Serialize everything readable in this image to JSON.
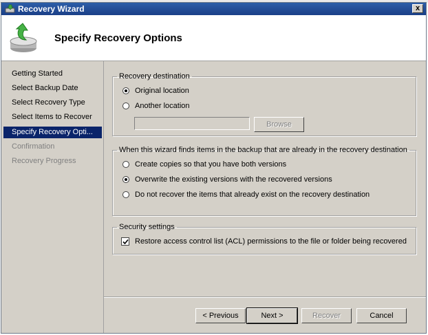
{
  "window": {
    "title": "Recovery Wizard",
    "close_label": "x"
  },
  "header": {
    "page_title": "Specify Recovery Options",
    "icon": "backup-restore-icon"
  },
  "nav": {
    "items": [
      {
        "label": "Getting Started",
        "state": "normal"
      },
      {
        "label": "Select Backup Date",
        "state": "normal"
      },
      {
        "label": "Select Recovery Type",
        "state": "normal"
      },
      {
        "label": "Select Items to Recover",
        "state": "normal"
      },
      {
        "label": "Specify Recovery Opti...",
        "state": "active"
      },
      {
        "label": "Confirmation",
        "state": "disabled"
      },
      {
        "label": "Recovery Progress",
        "state": "disabled"
      }
    ]
  },
  "destination": {
    "legend": "Recovery destination",
    "original_label": "Original location",
    "another_label": "Another location",
    "selected": "original",
    "path_value": "",
    "browse_label": "Browse"
  },
  "conflict": {
    "legend": "When this wizard finds items in the backup that are already in the recovery destination",
    "options": [
      "Create copies so that you have both versions",
      "Overwrite the existing versions with the recovered versions",
      "Do not recover the items that already exist on the recovery destination"
    ],
    "selected_index": 1
  },
  "security": {
    "legend": "Security settings",
    "acl_label": "Restore access control list (ACL) permissions to the file or folder being recovered",
    "acl_checked": true
  },
  "buttons": {
    "previous": "< Previous",
    "next": "Next >",
    "recover": "Recover",
    "cancel": "Cancel"
  },
  "colors": {
    "title_bar": "#1b3f87",
    "selection": "#0a246a",
    "face": "#d4d0c8"
  }
}
